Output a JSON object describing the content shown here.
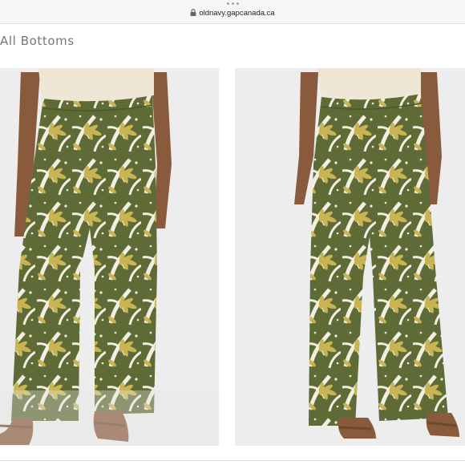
{
  "browser": {
    "url": "oldnavy.gapcanada.ca",
    "icons": [
      "more-dots-icon",
      "lock-icon"
    ]
  },
  "page": {
    "breadcrumb": "All Bottoms"
  },
  "product_images": [
    {
      "view": "front",
      "description_icon": "product-photo-front"
    },
    {
      "view": "back",
      "description_icon": "product-photo-back"
    }
  ],
  "colors": {
    "print_olive": "#5e6b36",
    "print_cream": "#f2efe1",
    "print_yellow": "#c9b454",
    "top_beige": "#efe6d6",
    "skin": "#8a5a3c",
    "background": "#ededed"
  }
}
